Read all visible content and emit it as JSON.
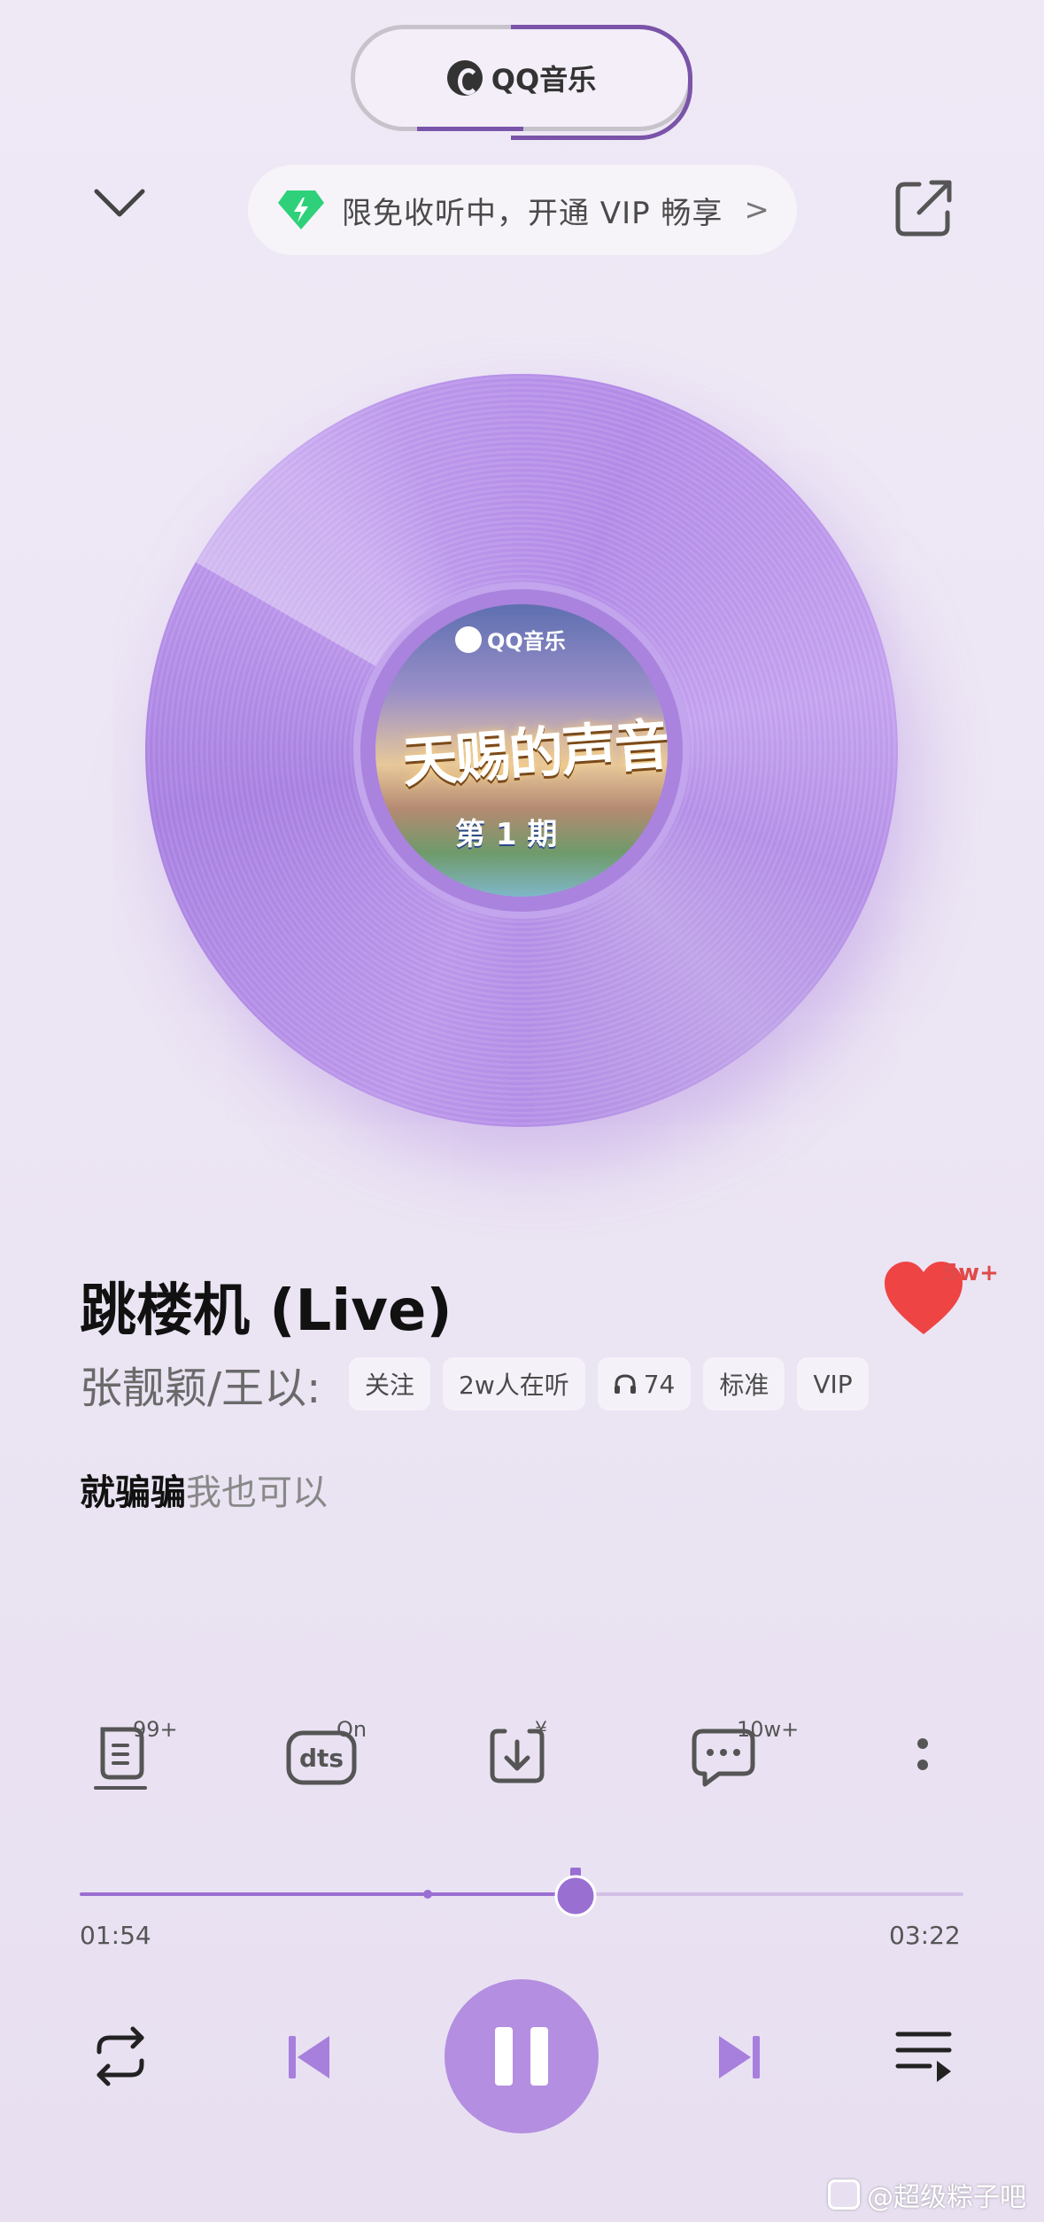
{
  "brand": {
    "name": "QQ音乐"
  },
  "vip_banner": {
    "text": "限免收听中，开通 VIP 畅享",
    "arrow": ">"
  },
  "cover": {
    "logo_text": "QQ音乐",
    "title": "天赐的声音",
    "episode": "第 1 期"
  },
  "song": {
    "title": "跳楼机 (Live)",
    "artist": "张靓颖/王以:",
    "likes": "5w+",
    "chips": {
      "follow": "关注",
      "listeners": "2w人在听",
      "headphone_count": "74",
      "quality": "标准",
      "vip": "VIP"
    }
  },
  "lyric": {
    "sung": "就骗骗",
    "rest": "我也可以"
  },
  "actions": {
    "lyrics_badge": "99+",
    "dts_badge": "On",
    "download_badge": "¥",
    "comments_badge": "10w+"
  },
  "progress": {
    "current": "01:54",
    "total": "03:22",
    "fraction": 0.561
  },
  "watermark": {
    "text": "@超级粽子吧"
  },
  "colors": {
    "accent": "#b48ee0",
    "like": "#ef4444",
    "vip_gem": "#2ed17a"
  }
}
